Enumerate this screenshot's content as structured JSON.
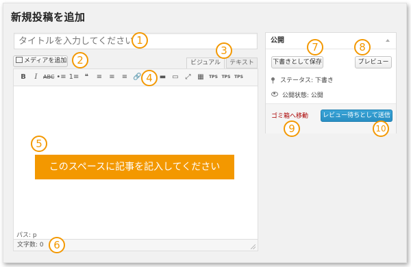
{
  "page": {
    "title": "新規投稿を追加"
  },
  "title_field": {
    "placeholder": "タイトルを入力してください"
  },
  "media_button": {
    "label": "メディアを追加"
  },
  "editor_tabs": {
    "visual": "ビジュアル",
    "text": "テキスト"
  },
  "toolbar": {
    "buttons": [
      "B",
      "I",
      "ABC",
      "•≡",
      "1≡",
      "❝",
      "≡",
      "≡",
      "≡",
      "🔗",
      "⛓",
      "▬",
      "▭",
      "⤢",
      "▦",
      "TPS",
      "TPS",
      "TPS"
    ]
  },
  "editor": {
    "banner": "このスペースに記事を記入してください",
    "path_label": "パス: p",
    "word_count": "文字数: 0"
  },
  "publish_box": {
    "title": "公開",
    "save_draft": "下書きとして保存",
    "preview": "プレビュー",
    "status": "ステータス: 下書き",
    "visibility": "公開状態: 公開",
    "trash": "ゴミ箱へ移動",
    "submit": "レビュー待ちとして送信"
  },
  "callouts": [
    "1",
    "2",
    "3",
    "4",
    "5",
    "6",
    "7",
    "8",
    "9",
    "10"
  ],
  "colors": {
    "accent": "#f39800",
    "primary_button": "#2a8fc3",
    "trash_link": "#aa0000"
  }
}
